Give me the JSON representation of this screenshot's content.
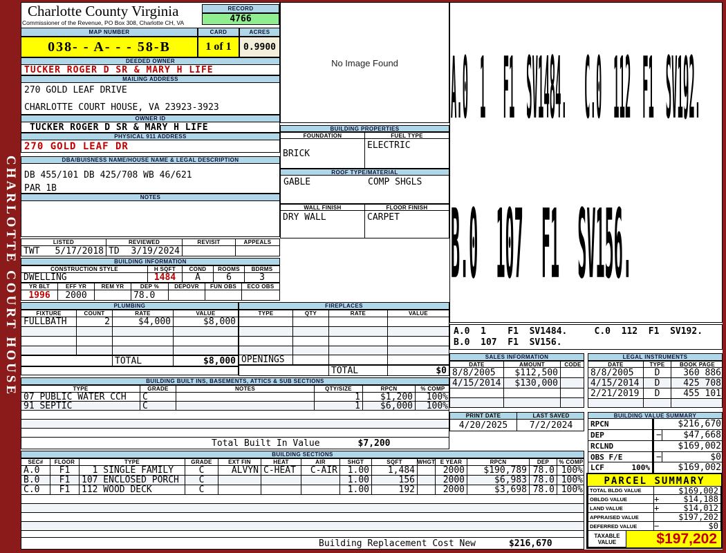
{
  "colors": {
    "maroon": "#8B1B1B",
    "header_blue": "#AFD7E8",
    "record_green": "#90EE90",
    "yellow": "#FFFF00",
    "cream": "#F3EFDA",
    "red": "#C00000"
  },
  "sidebar": {
    "title": "CHARLOTTE COURT HOUSE"
  },
  "header": {
    "county": "Charlotte County Virginia",
    "commissioner": "Commissioner of the Revenue, PO Box 308, Charlotte CH, VA",
    "record_label": "RECORD",
    "record": "4766",
    "map_label": "MAP NUMBER",
    "map": "038- - A- -  - 58-B",
    "card_label": "CARD",
    "card": "1 of 1",
    "acres_label": "ACRES",
    "acres": "0.9900"
  },
  "owner": {
    "deeded_label": "DEEDED OWNER",
    "deeded": "TUCKER ROGER D SR & MARY H LIFE",
    "mailing_label": "MAILING ADDRESS",
    "mail1": "270 GOLD LEAF DRIVE",
    "mail2": "CHARLOTTE COURT HOUSE, VA 23923-3923",
    "owner_id_label": "OWNER ID",
    "owner_id": "TUCKER ROGER D SR & MARY H LIFE",
    "physical_label": "PHYSICAL 911 ADDRESS",
    "physical": "270 GOLD LEAF DR"
  },
  "legal": {
    "dba_label": "DBA/BUISNESS NAME/HOUSE NAME & LEGAL DESCRIPTION",
    "line1": "DB 455/101 DB 425/708 WB 46/621",
    "line2": "PAR 1B",
    "notes_label": "NOTES"
  },
  "review": {
    "listed_label": "LISTED",
    "reviewed_label": "REVIEWED",
    "revisit_label": "REVISIT",
    "appeals_label": "APPEALS",
    "listed_by": "TWT",
    "listed_date": "5/17/2018",
    "reviewed_by": "TD",
    "reviewed_date": "3/19/2024"
  },
  "building_info": {
    "title": "BUILDING INFORMATION",
    "style_label": "CONSTRUCTION STYLE",
    "hsqft_label": "H SQFT",
    "cond_label": "COND",
    "rooms_label": "ROOMS",
    "bdrms_label": "BDRMS",
    "style": "DWELLING",
    "hsqft": "1484",
    "cond": "A",
    "rooms": "6",
    "bdrms": "3",
    "yrblt_label": "YR BLT",
    "effyr_label": "EFF YR",
    "remyr_label": "REM YR",
    "dep_label": "DEP %",
    "depovr_label": "DEPOVR",
    "funobs_label": "FUN OBS",
    "ecoobs_label": "ECO OBS",
    "yrblt": "1996",
    "effyr": "2000",
    "dep": "78.0"
  },
  "building_properties": {
    "title": "BUILDING PROPERTIES",
    "foundation_label": "FOUNDATION",
    "fuel_label": "FUEL TYPE",
    "foundation": "BRICK",
    "fuel": "ELECTRIC",
    "roof_label": "ROOF TYPE/MATERIAL",
    "roof_type": "GABLE",
    "roof_material": "COMP SHGLS",
    "wall_label": "WALL FINISH",
    "floor_label": "FLOOR FINISH",
    "wall": "DRY WALL",
    "floor": "CARPET"
  },
  "no_image": {
    "text": "No Image Found"
  },
  "sketch": {
    "big_line1": "A.0  1   F1  SV1484.   C.0  112  F1  SV192.",
    "big_line2": "B.0  107  F1  SV156.",
    "legend1": "A.0  1    F1  SV1484.     C.0  112  F1  SV192.",
    "legend2": "B.0  107  F1  SV156."
  },
  "plumbing": {
    "title": "PLUMBING",
    "cols": [
      "FIXTURE",
      "COUNT",
      "RATE",
      "VALUE"
    ],
    "rows": [
      {
        "fixture": "FULLBATH",
        "count": "2",
        "rate": "$4,000",
        "value": "$8,000"
      }
    ],
    "total_label": "TOTAL",
    "total": "$8,000"
  },
  "fireplaces": {
    "title": "FIREPLACES",
    "cols": [
      "TYPE",
      "QTY",
      "RATE",
      "VALUE"
    ],
    "openings_label": "OPENINGS",
    "total_label": "TOTAL",
    "total": "$0"
  },
  "builtins": {
    "title": "BUILDING BUILT INS, BASEMENTS, ATTICS & SUB SECTIONS",
    "cols": [
      "TYPE",
      "GRADE",
      "NOTES",
      "QTY/SIZE",
      "RPCN",
      "% COMP"
    ],
    "rows": [
      {
        "type": "07 PUBLIC WATER CCH",
        "grade": "C",
        "qty": "1",
        "rpcn": "$1,200",
        "comp": "100%"
      },
      {
        "type": "91 SEPTIC",
        "grade": "C",
        "qty": "1",
        "rpcn": "$6,000",
        "comp": "100%"
      }
    ],
    "total_label": "Total Built In Value",
    "total": "$7,200"
  },
  "sections": {
    "title": "BUILDING SECTIONS",
    "cols": [
      "SEC#",
      "FLOOR",
      "TYPE",
      "GRADE",
      "EXT FIN",
      "HEAT",
      "AIR",
      "SHGT",
      "SQFT",
      "WHGT",
      "E YEAR",
      "RPCN",
      "DEP",
      "% COMP"
    ],
    "rows": [
      {
        "sec": "A.0",
        "floor": "F1",
        "type": "  1 SINGLE FAMILY",
        "grade": "C",
        "ext": "ALVYN",
        "heat": "C-HEAT",
        "air": "C-AIR",
        "shgt": "1.00",
        "sqft": "1,484",
        "eyear": "2000",
        "rpcn": "$190,789",
        "dep": "78.0",
        "comp": "100%"
      },
      {
        "sec": "B.0",
        "floor": "F1",
        "type": "107 ENCLOSED PORCH",
        "grade": "C",
        "ext": "",
        "heat": "",
        "air": "",
        "shgt": "1.00",
        "sqft": "156",
        "eyear": "2000",
        "rpcn": "$6,983",
        "dep": "78.0",
        "comp": "100%"
      },
      {
        "sec": "C.0",
        "floor": "F1",
        "type": "112 WOOD DECK",
        "grade": "C",
        "ext": "",
        "heat": "",
        "air": "",
        "shgt": "1.00",
        "sqft": "192",
        "eyear": "2000",
        "rpcn": "$3,698",
        "dep": "78.0",
        "comp": "100%"
      }
    ],
    "footer_label": "Building Replacement Cost New",
    "footer_value": "$216,670"
  },
  "sales": {
    "title": "SALES INFORMATION",
    "cols": [
      "DATE",
      "AMOUNT",
      "CODE"
    ],
    "rows": [
      {
        "date": "8/8/2005",
        "amount": "$112,500"
      },
      {
        "date": "4/15/2014",
        "amount": "$130,000"
      }
    ]
  },
  "instruments": {
    "title": "LEGAL INSTRUMENTS",
    "cols": [
      "DATE",
      "TYPE",
      "BOOK PAGE"
    ],
    "rows": [
      {
        "date": "8/8/2005",
        "type": "D",
        "book": "360 886"
      },
      {
        "date": "4/15/2014",
        "type": "D",
        "book": "425 708"
      },
      {
        "date": "2/21/2019",
        "type": "D",
        "book": "455 101"
      }
    ]
  },
  "print_info": {
    "print_label": "PRINT DATE",
    "saved_label": "LAST SAVED",
    "print_date": "4/20/2025",
    "last_saved": "7/2/2024"
  },
  "value_summary": {
    "title": "BUILDING VALUE SUMMARY",
    "rows": [
      {
        "label": "RPCN",
        "sign": "",
        "value": "$216,670"
      },
      {
        "label": "DEP",
        "sign": "−",
        "value": "$47,668"
      },
      {
        "label": "RCLND",
        "sign": "",
        "value": "$169,002"
      },
      {
        "label": "OBS F/E",
        "sign": "−",
        "value": "$0"
      },
      {
        "label": "LCF",
        "pct": "100%",
        "sign": "",
        "value": "$169,002"
      }
    ]
  },
  "parcel": {
    "title": "PARCEL SUMMARY",
    "rows": [
      {
        "label": "TOTAL BLDG VALUE",
        "sign": "",
        "value": "$169,002"
      },
      {
        "label": "OBLDG VALUE",
        "sign": "+",
        "value": "$14,188"
      },
      {
        "label": "LAND VALUE",
        "sign": "+",
        "value": "$14,012"
      },
      {
        "label": "APPRAISED VALUE",
        "sign": "",
        "value": "$197,202"
      },
      {
        "label": "DEFERRED VALUE",
        "sign": "−",
        "value": "$0"
      }
    ],
    "taxable_label1": "TAXABLE",
    "taxable_label2": "VALUE",
    "taxable": "$197,202"
  }
}
